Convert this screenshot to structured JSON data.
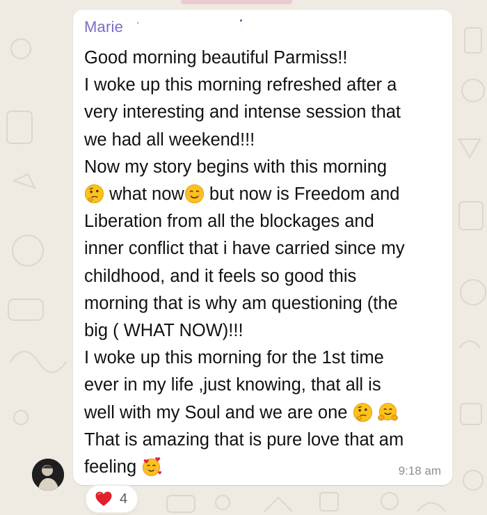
{
  "message": {
    "sender": "Marie",
    "sender_suffix": "'",
    "time": "9:18 am",
    "lines": {
      "l1": "Good morning beautiful Parmiss!!",
      "l2": "I woke up this morning refreshed after a",
      "l3": "very interesting and intense session that",
      "l4": "we had all weekend!!!",
      "l5": "Now my story begins with this morning",
      "l6a": "what now",
      "l6b": "but now is Freedom and",
      "l7": "Liberation from all the blockages and",
      "l8": "inner conflict that i have carried since my",
      "l9": "childhood, and it feels so good this",
      "l10": "morning that is why am questioning (the",
      "l11": "big ( WHAT NOW)!!!",
      "l12": "I woke up this morning for the 1st time",
      "l13": "ever in my life ,just knowing, that all is",
      "l14": "well with my Soul and we are one",
      "l15": "That is amazing that is pure love that am",
      "l16": "feeling"
    },
    "emojis": [
      "thinking-face",
      "smiling-face",
      "thinking-face",
      "hugging-face",
      "smiling-face-with-hearts"
    ]
  },
  "reaction": {
    "emoji": "red-heart",
    "count": "4"
  },
  "colors": {
    "sender": "#7c6cc8",
    "bubble": "#ffffff",
    "background": "#efeae2",
    "timestamp": "#8a8f93"
  }
}
